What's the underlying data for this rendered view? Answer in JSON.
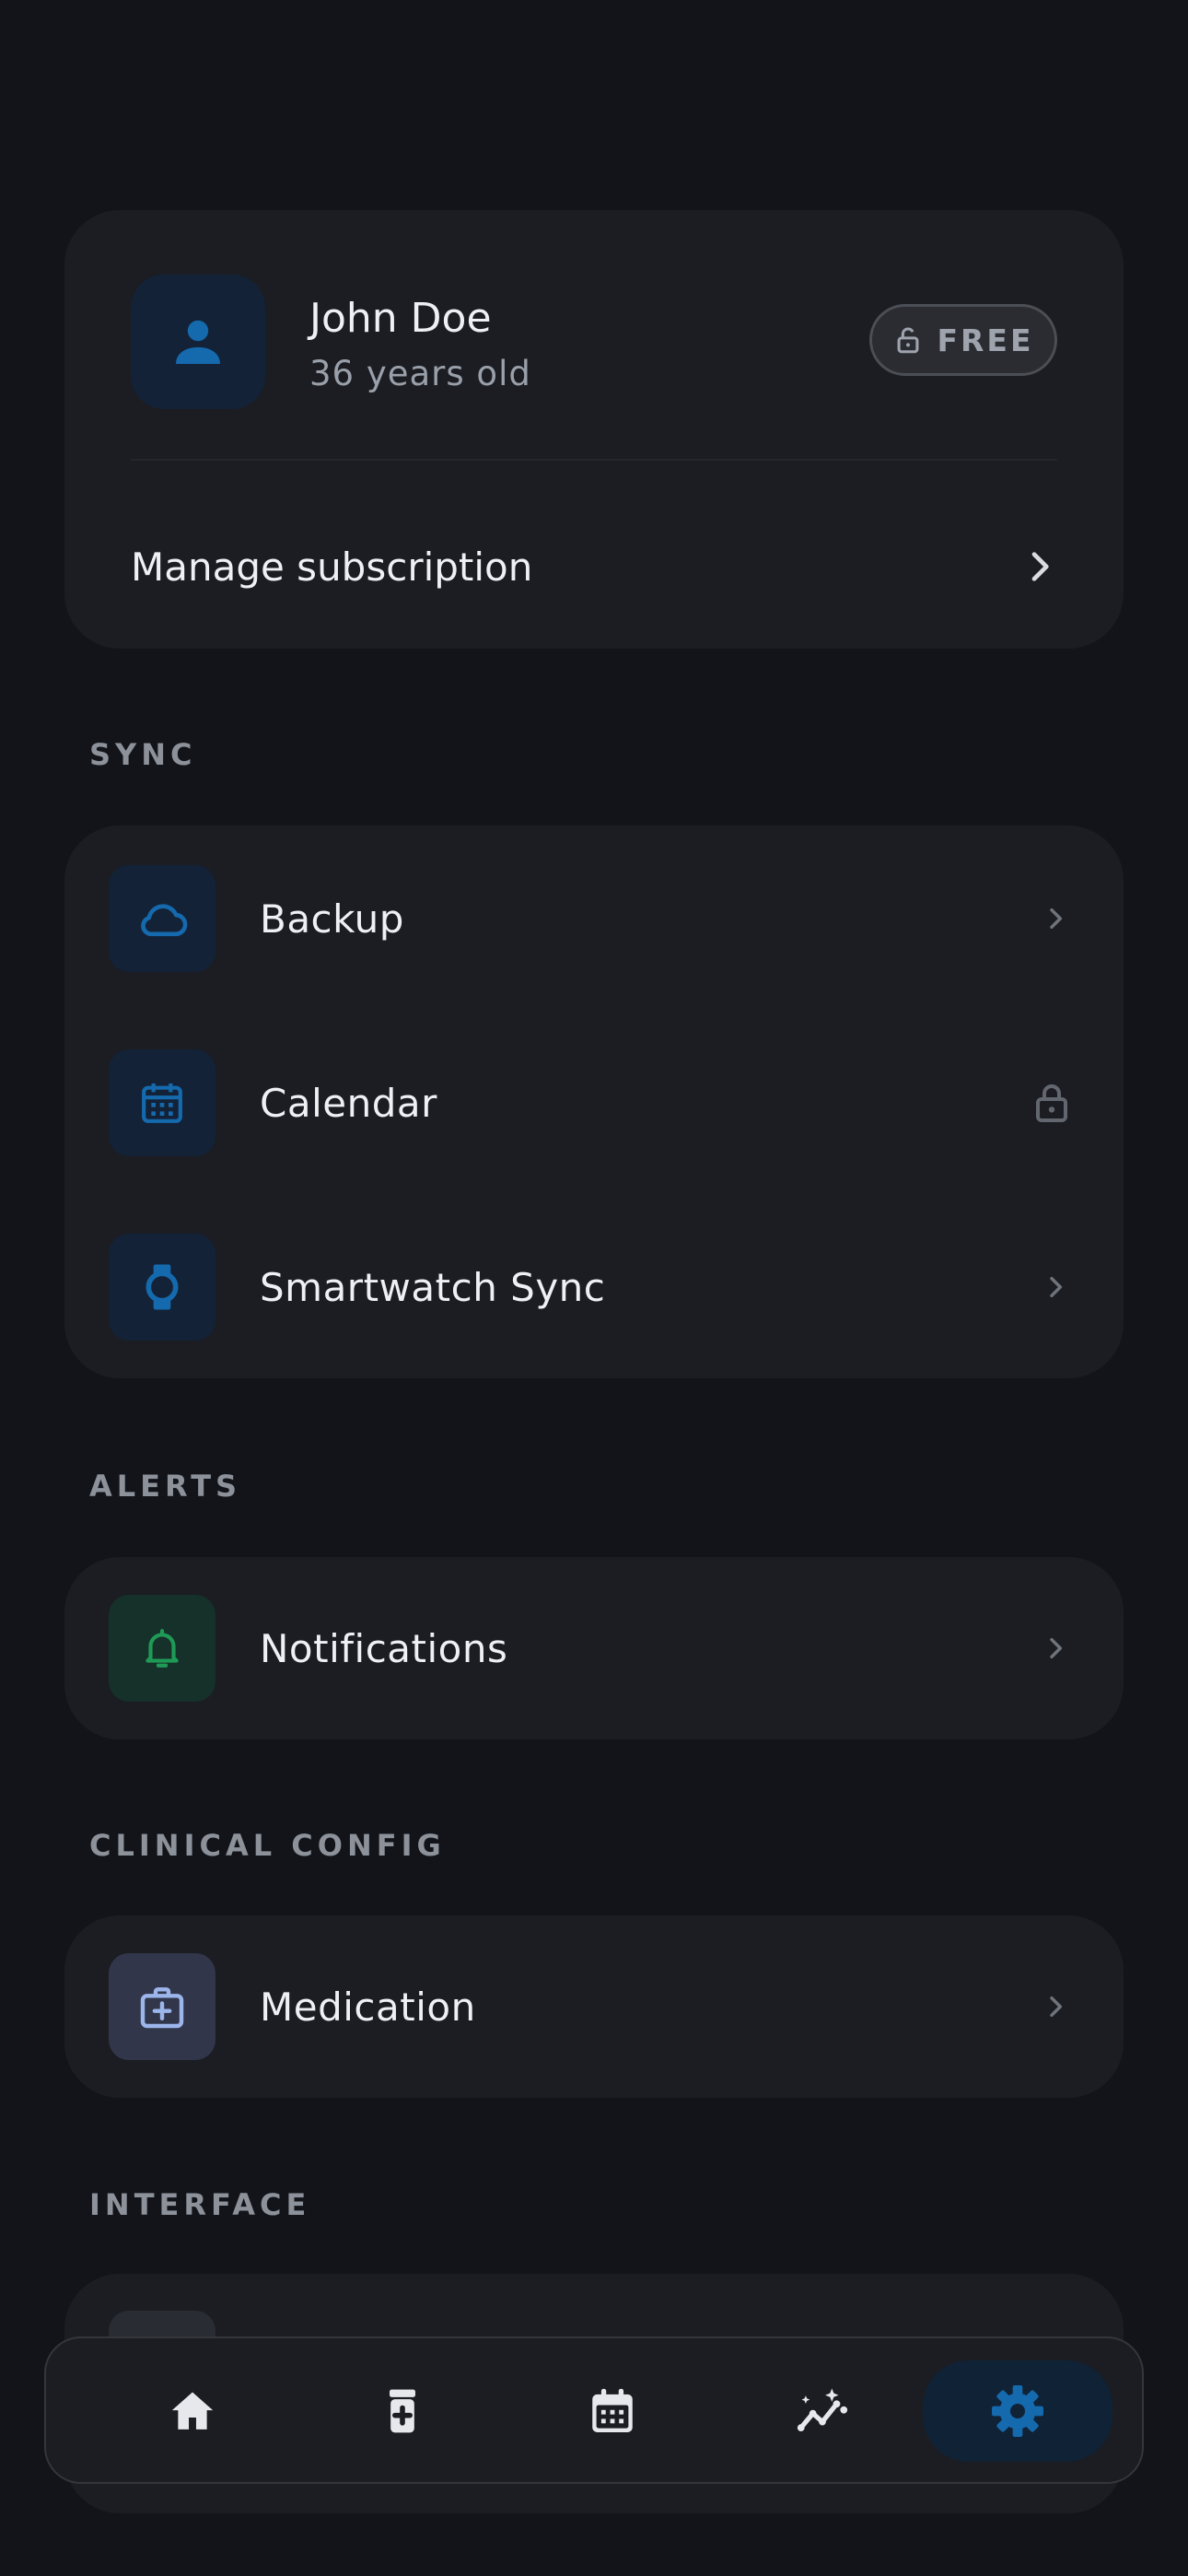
{
  "profile": {
    "name": "John Doe",
    "age": "36 years old",
    "plan_badge": "FREE",
    "manage_label": "Manage subscription",
    "avatar_icon": "person-icon",
    "badge_icon": "unlock-icon"
  },
  "sections": {
    "sync": "SYNC",
    "alerts": "ALERTS",
    "clinical": "CLINICAL CONFIG",
    "interface": "INTERFACE"
  },
  "sync_items": [
    {
      "label": "Backup",
      "icon": "cloud-icon",
      "trailing": "chevron-right-icon"
    },
    {
      "label": "Calendar",
      "icon": "calendar-icon",
      "trailing": "lock-icon"
    },
    {
      "label": "Smartwatch Sync",
      "icon": "watch-icon",
      "trailing": "chevron-right-icon"
    }
  ],
  "alerts_items": [
    {
      "label": "Notifications",
      "icon": "bell-icon",
      "trailing": "chevron-right-icon"
    }
  ],
  "clinical_items": [
    {
      "label": "Medication",
      "icon": "medical-kit-icon",
      "trailing": "chevron-right-icon"
    }
  ],
  "nav": [
    {
      "name": "home",
      "icon": "home-icon",
      "active": false
    },
    {
      "name": "medication",
      "icon": "pill-bottle-icon",
      "active": false
    },
    {
      "name": "calendar",
      "icon": "calendar-icon",
      "active": false
    },
    {
      "name": "insights",
      "icon": "trend-sparkle-icon",
      "active": false
    },
    {
      "name": "settings",
      "icon": "gear-icon",
      "active": true
    }
  ],
  "colors": {
    "background": "#121419",
    "card": "#1b1d22",
    "accent_blue": "#1569ad",
    "accent_green": "#1f9a56",
    "text_primary": "#eef0f4",
    "text_secondary": "#9aa0aa"
  }
}
